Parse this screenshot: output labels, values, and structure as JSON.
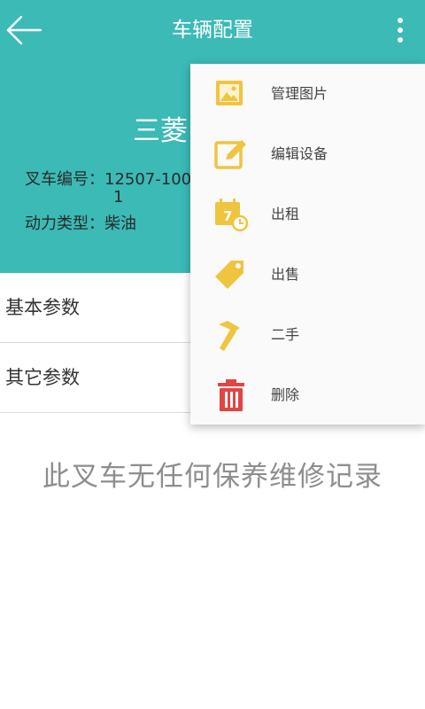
{
  "header": {
    "title": "车辆配置",
    "model_name": "三菱"
  },
  "info": {
    "forklift_no_label": "叉车编号：",
    "forklift_no_value_line1": "12507-100",
    "forklift_no_value_line2": "1",
    "power_type_label": "动力类型：",
    "power_type_value": "柴油"
  },
  "list": {
    "basic_params": "基本参数",
    "other_params": "其它参数"
  },
  "empty_message": "此叉车无任何保养维修记录",
  "menu": {
    "items": [
      {
        "label": "管理图片",
        "icon": "image-icon"
      },
      {
        "label": "编辑设备",
        "icon": "edit-icon"
      },
      {
        "label": "出租",
        "icon": "calendar-clock-icon"
      },
      {
        "label": "出售",
        "icon": "price-tag-icon"
      },
      {
        "label": "二手",
        "icon": "hammer-icon"
      },
      {
        "label": "删除",
        "icon": "trash-icon"
      }
    ]
  },
  "colors": {
    "header_bg": "#3bbab6",
    "icon_yellow": "#f0c43f",
    "icon_red": "#e24444"
  }
}
